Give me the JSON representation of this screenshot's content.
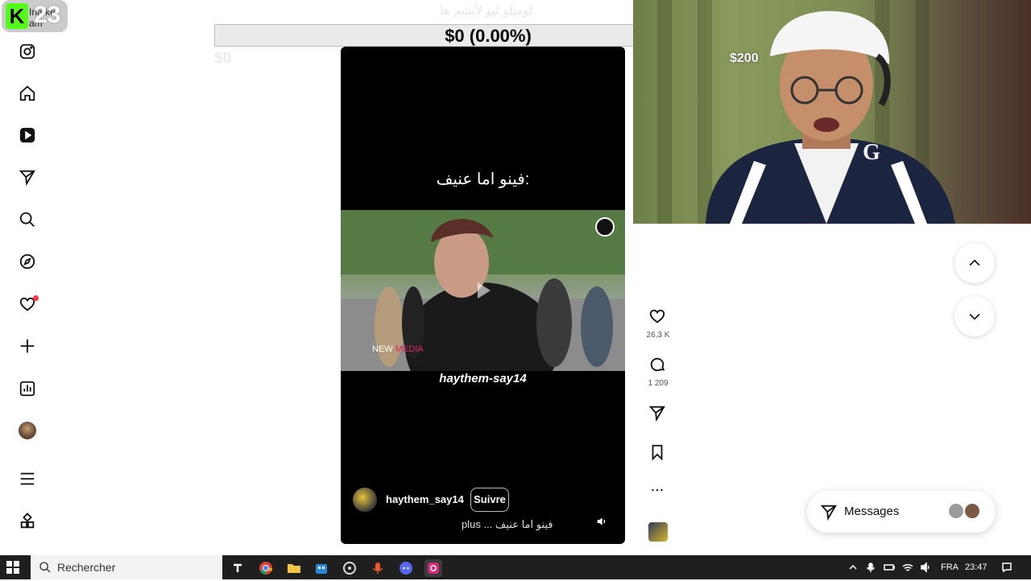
{
  "overlay": {
    "kick_label": "Ina ke am",
    "kick_count": "23",
    "donation_title": "لوميلو ليو لأنشم ها",
    "donation_bar": "$0 (0.00%)",
    "donation_left": "$0",
    "donation_goal": "$200"
  },
  "sidebar": {
    "items": [
      {
        "icon": "instagram-logo-icon"
      },
      {
        "icon": "home-icon"
      },
      {
        "icon": "reels-icon"
      },
      {
        "icon": "send-icon"
      },
      {
        "icon": "search-icon"
      },
      {
        "icon": "explore-icon"
      },
      {
        "icon": "notifications-heart-icon"
      },
      {
        "icon": "create-plus-icon"
      },
      {
        "icon": "dashboard-icon"
      },
      {
        "icon": "profile-avatar-icon"
      },
      {
        "icon": "menu-icon"
      },
      {
        "icon": "also-from-meta-icon"
      }
    ]
  },
  "reel": {
    "caption": "فينو اما عنيف:",
    "overlay_username": "haythem-say14",
    "watermark_brand": "NEW MEDIA",
    "watermark_brand_a": "NEW ",
    "watermark_brand_b": "MEDIA",
    "author": "haythem_say14",
    "follow_label": "Suivre",
    "description": "plus ... فينو اما عنيف",
    "sound_icon": "volume-icon"
  },
  "actions": {
    "likes": "26,3 K",
    "comments": "1 209"
  },
  "messages": {
    "label": "Messages"
  },
  "taskbar": {
    "search_placeholder": "Rechercher",
    "language": "FRA",
    "clock": "23:47"
  }
}
